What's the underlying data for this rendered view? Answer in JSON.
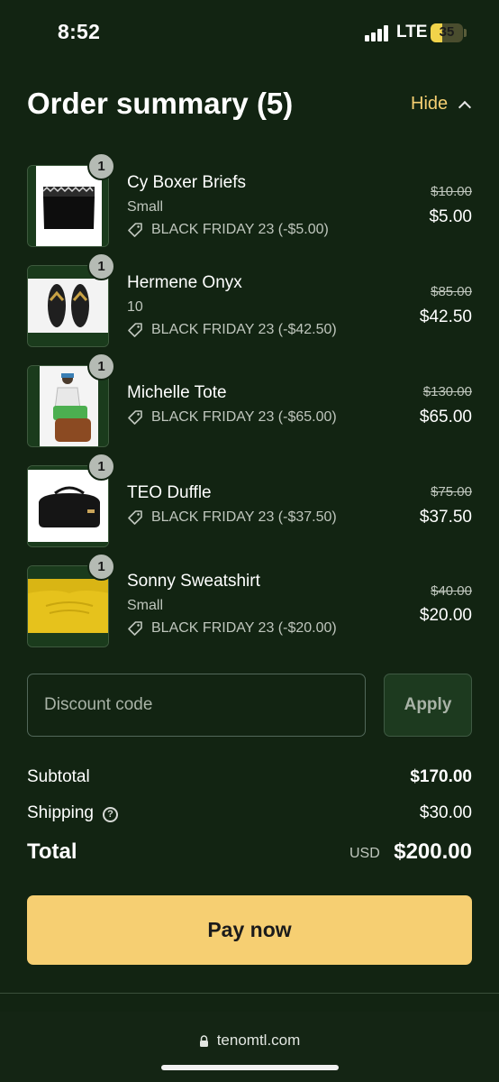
{
  "status_bar": {
    "time": "8:52",
    "network": "LTE",
    "battery_level": "35",
    "icons": [
      "signal-icon",
      "battery-icon"
    ]
  },
  "header": {
    "title": "Order summary (5)",
    "toggle_label": "Hide",
    "toggle_icon": "chevron-up-icon"
  },
  "items": [
    {
      "quantity": "1",
      "name": "Cy Boxer Briefs",
      "variant": "Small",
      "discount": "BLACK FRIDAY 23 (-$5.00)",
      "original_price": "$10.00",
      "price": "$5.00",
      "image": "black boxer briefs"
    },
    {
      "quantity": "1",
      "name": "Hermene Onyx",
      "variant": "10",
      "discount": "BLACK FRIDAY 23 (-$42.50)",
      "original_price": "$85.00",
      "price": "$42.50",
      "image": "black sandals"
    },
    {
      "quantity": "1",
      "name": "Michelle Tote",
      "variant": "",
      "discount": "BLACK FRIDAY 23 (-$65.00)",
      "original_price": "$130.00",
      "price": "$65.00",
      "image": "model holding tote bags"
    },
    {
      "quantity": "1",
      "name": "TEO Duffle",
      "variant": "",
      "discount": "BLACK FRIDAY 23 (-$37.50)",
      "original_price": "$75.00",
      "price": "$37.50",
      "image": "black duffle bag"
    },
    {
      "quantity": "1",
      "name": "Sonny Sweatshirt",
      "variant": "Small",
      "discount": "BLACK FRIDAY 23 (-$20.00)",
      "original_price": "$40.00",
      "price": "$20.00",
      "image": "yellow sweatshirt"
    }
  ],
  "discount": {
    "placeholder": "Discount code",
    "apply_label": "Apply"
  },
  "totals": {
    "subtotal_label": "Subtotal",
    "subtotal_value": "$170.00",
    "shipping_label": "Shipping",
    "shipping_value": "$30.00",
    "total_label": "Total",
    "currency": "USD",
    "total_value": "$200.00"
  },
  "pay_button_label": "Pay now",
  "browser": {
    "url": "tenomtl.com"
  },
  "colors": {
    "background": "#122412",
    "accent": "#f6cf72",
    "muted_text": "#bfc6bd"
  }
}
